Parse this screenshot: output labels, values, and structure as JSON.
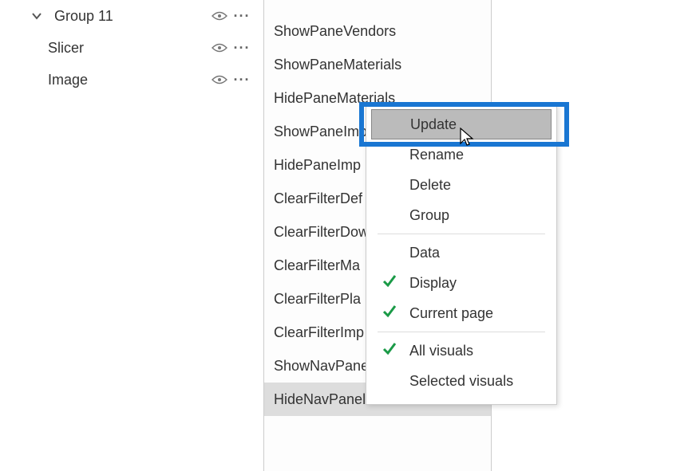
{
  "left_panel": {
    "group_label": "Group 11",
    "item_slicer": "Slicer",
    "item_image": "Image"
  },
  "bookmarks": [
    "ShowPaneVendors",
    "ShowPaneMaterials",
    "HidePaneMaterials",
    "ShowPaneImp",
    "HidePaneImp",
    "ClearFilterDef",
    "ClearFilterDow",
    "ClearFilterMa",
    "ClearFilterPla",
    "ClearFilterImp",
    "ShowNavPane",
    "HideNavPanel"
  ],
  "selected_bookmark_index": 11,
  "menu": {
    "update": "Update",
    "rename": "Rename",
    "delete": "Delete",
    "group": "Group",
    "data": "Data",
    "display": "Display",
    "current_page": "Current page",
    "all_visuals": "All visuals",
    "selected_visuals": "Selected visuals"
  }
}
